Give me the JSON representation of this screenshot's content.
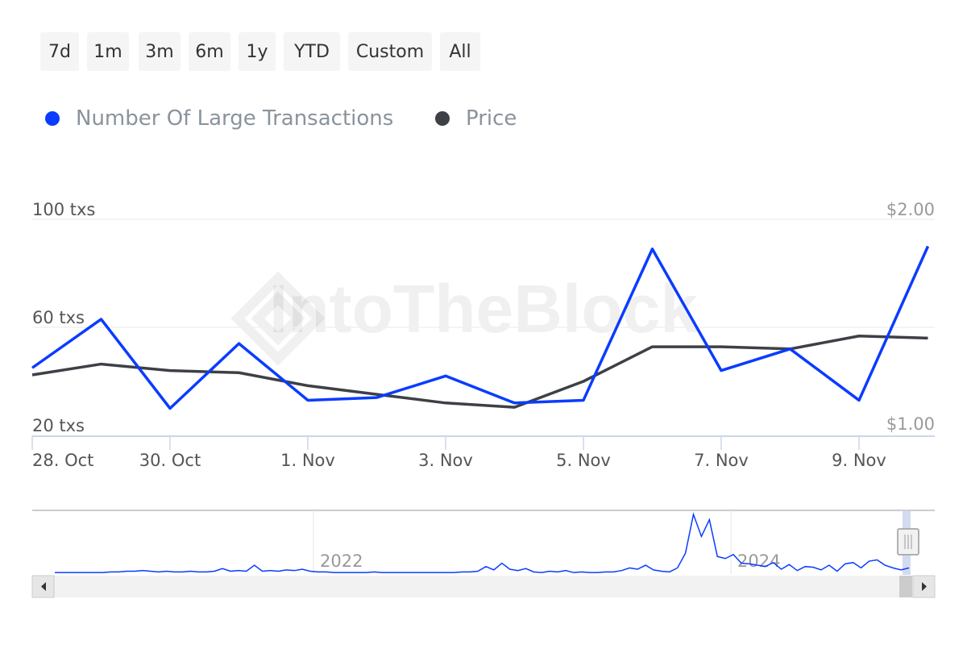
{
  "range_buttons": [
    "7d",
    "1m",
    "3m",
    "6m",
    "1y",
    "YTD",
    "Custom",
    "All"
  ],
  "watermark": "IntoTheBlock",
  "colors": {
    "transactions": "#0a3cff",
    "price": "#3d4045",
    "axis": "#ccd6eb",
    "grid": "#f0f0f0"
  },
  "chart_data": {
    "type": "line",
    "x": [
      "28 Oct",
      "29 Oct",
      "30 Oct",
      "31 Oct",
      "1 Nov",
      "2 Nov",
      "3 Nov",
      "4 Nov",
      "5 Nov",
      "6 Nov",
      "7 Nov",
      "8 Nov",
      "9 Nov",
      "10 Nov"
    ],
    "x_tick_labels": [
      "28. Oct",
      "30. Oct",
      "1. Nov",
      "3. Nov",
      "5. Nov",
      "7. Nov",
      "9. Nov"
    ],
    "series": [
      {
        "name": "Number Of Large Transactions",
        "axis": "left",
        "color": "#0a3cff",
        "values": [
          45,
          63,
          30,
          54,
          33,
          34,
          42,
          32,
          33,
          89,
          44,
          52,
          33,
          90
        ]
      },
      {
        "name": "Price",
        "axis": "right",
        "color": "#3d4045",
        "values": [
          1.28,
          1.33,
          1.3,
          1.29,
          1.23,
          1.19,
          1.15,
          1.13,
          1.25,
          1.41,
          1.41,
          1.4,
          1.46,
          1.45
        ]
      }
    ],
    "left_axis": {
      "ticks": [
        "100 txs",
        "60 txs",
        "20 txs"
      ],
      "range": [
        20,
        100
      ]
    },
    "right_axis": {
      "ticks": [
        "$2.00",
        "$1.00"
      ],
      "range": [
        1,
        2
      ]
    },
    "grid": true,
    "legend_placement": "top-left",
    "navigator": {
      "labels": [
        "2022",
        "2024"
      ],
      "values": [
        1,
        1,
        1,
        1,
        1,
        1,
        1,
        2,
        2,
        3,
        3,
        4,
        3,
        2,
        3,
        2,
        2,
        3,
        2,
        2,
        3,
        7,
        3,
        4,
        3,
        12,
        3,
        4,
        3,
        5,
        4,
        6,
        3,
        2,
        2,
        1,
        1,
        1,
        1,
        1,
        2,
        1,
        1,
        1,
        1,
        1,
        1,
        1,
        1,
        1,
        1,
        2,
        2,
        3,
        10,
        5,
        15,
        6,
        4,
        7,
        2,
        1,
        3,
        2,
        4,
        1,
        2,
        1,
        1,
        2,
        2,
        4,
        8,
        6,
        12,
        5,
        3,
        2,
        8,
        30,
        88,
        55,
        80,
        25,
        22,
        28,
        15,
        14,
        12,
        10,
        16,
        6,
        13,
        4,
        10,
        9,
        5,
        12,
        3,
        14,
        16,
        8,
        18,
        20,
        12,
        8,
        5,
        8
      ]
    }
  }
}
